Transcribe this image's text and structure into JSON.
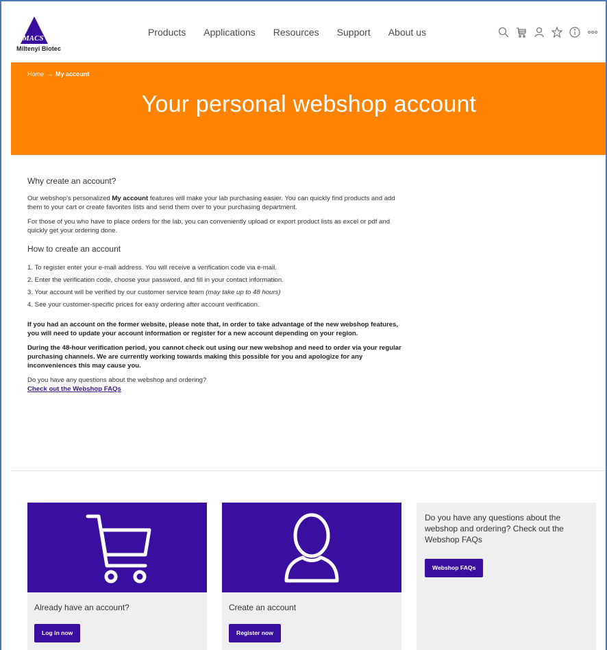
{
  "brand": {
    "logo_mark": "MACS",
    "name": "Miltenyi Biotec",
    "primary_color": "#3a0fa0",
    "accent_color": "#ff8200"
  },
  "nav": {
    "items": [
      "Products",
      "Applications",
      "Resources",
      "Support",
      "About us"
    ]
  },
  "tools": [
    "search-icon",
    "cart-icon",
    "user-icon",
    "star-icon",
    "info-icon",
    "more-icon"
  ],
  "breadcrumb": {
    "home": "Home",
    "separator": "→",
    "current": "My account"
  },
  "hero": {
    "title": "Your personal webshop account"
  },
  "content": {
    "why_heading": "Why create an account?",
    "why_p1_pre": "Our webshop's personalized ",
    "why_p1_bold": "My account",
    "why_p1_post": " features will make your lab purchasing easier. You can quickly find products and add them to your cart or create favorites lists and send them over to your purchasing department.",
    "why_p2": "For those of you who have to place orders for the lab, you can conveniently upload or export product lists as excel or pdf and quickly get your ordering done.",
    "how_heading": "How to create an account",
    "steps": [
      "1. To register enter your e-mail address. You will receive a verification code via e-mail.",
      "2. Enter the verification code, choose your password, and fill in your contact information.",
      "3. Your account will be verified by our customer service team ",
      "4. See your customer-specific prices for easy ordering after account verification."
    ],
    "step3_note": "(may take up to 48 hours)",
    "notice1": "If you had an account on the former website, please note that, in order to take advantage of the new webshop features, you will need to update your account information or register for a new account depending on your region.",
    "notice2": "During the 48-hour verification period, you cannot check out using our new webshop and need to order via your regular purchasing channels. We are currently working towards making this possible for you and apologize for any inconveniences this may cause you.",
    "question": "Do you have any questions about the webshop and ordering?",
    "faq_link": "Check out the Webshop FAQs"
  },
  "cards": {
    "login": {
      "title": "Already have an account?",
      "button": "Log in now"
    },
    "register": {
      "title": "Create an account",
      "button": "Register now"
    },
    "faq": {
      "text": "Do you have any questions about the webshop and ordering? Check out the Webshop FAQs",
      "button": "Webshop FAQs"
    }
  }
}
